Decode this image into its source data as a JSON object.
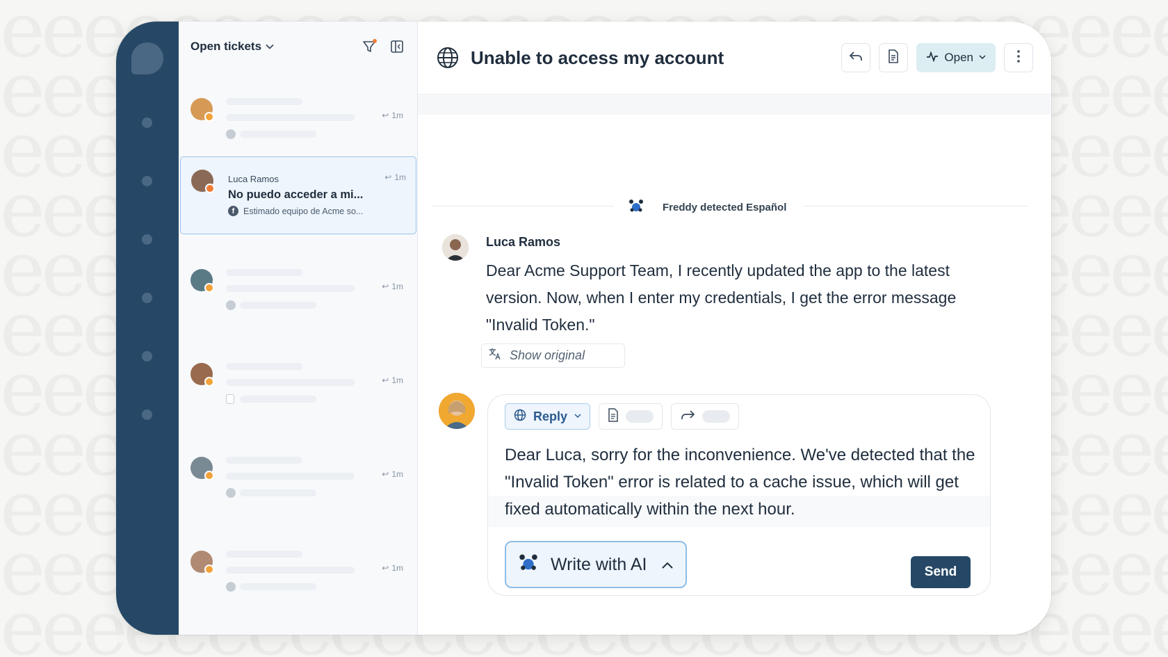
{
  "list": {
    "title": "Open tickets",
    "active_ticket": {
      "name": "Luca Ramos",
      "subject": "No puedo acceder a mi...",
      "preview": "Estimado equipo de Acme so...",
      "time": "1m"
    },
    "placeholder_times": [
      "1m",
      "1m",
      "1m",
      "1m",
      "1m"
    ]
  },
  "ticket": {
    "title": "Unable to access my account",
    "status": "Open"
  },
  "conversation": {
    "detected_language": "Freddy detected Español",
    "sender": "Luca Ramos",
    "message": "Dear Acme Support Team, I recently updated the app to the latest version. Now, when I enter my credentials, I get the error message \"Invalid Token.\"",
    "show_original": "Show original"
  },
  "composer": {
    "reply_label": "Reply",
    "reply_text": "Dear Luca, sorry for the inconvenience. We've detected that the \"Invalid Token\" error is related to a cache issue, which will get fixed automatically within the next hour.",
    "write_ai_label": "Write with AI",
    "send_label": "Send"
  },
  "colors": {
    "rail": "#264866",
    "accent_border": "#9cc3ea",
    "status_bg": "#dceef2",
    "badge": "#f2a23a"
  },
  "icons": [
    "filter-icon",
    "sidebar-toggle-icon",
    "globe-icon",
    "reply-arrow-icon",
    "notes-icon",
    "activity-icon",
    "more-vertical-icon",
    "freddy-ai-icon",
    "translate-icon",
    "forward-icon",
    "facebook-icon",
    "chevron-down-icon",
    "chevron-up-icon"
  ]
}
